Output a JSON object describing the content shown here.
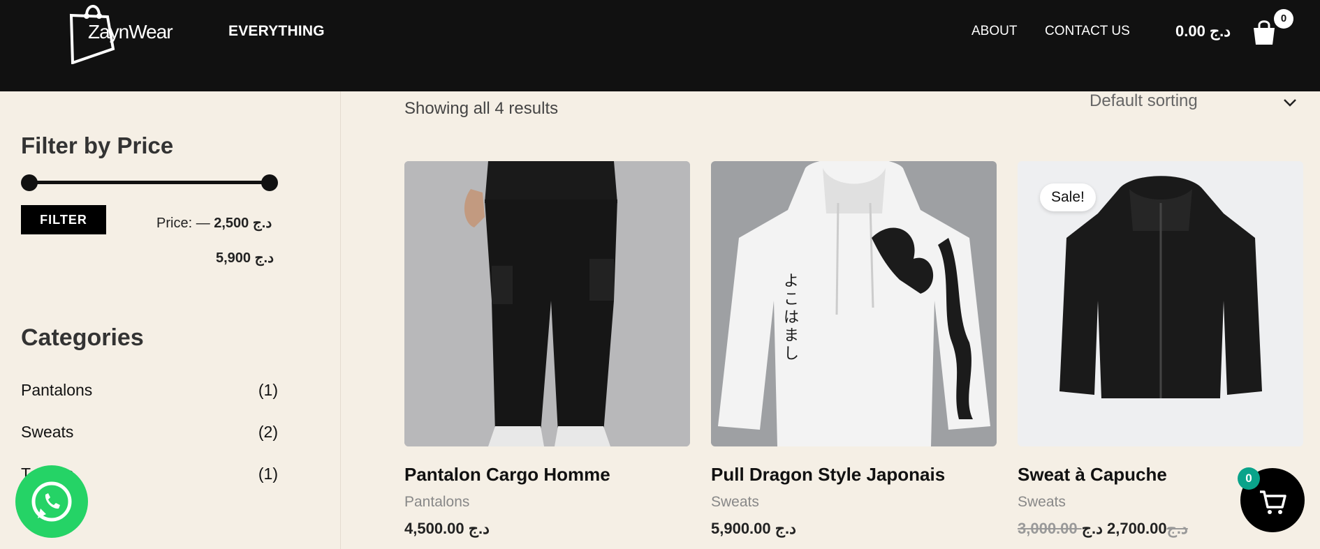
{
  "header": {
    "logo_text": "ZaynWear",
    "nav_everything": "EVERYTHING",
    "nav_about": "ABOUT",
    "nav_contact": "CONTACT US",
    "cart_total": "0.00 د.ج",
    "cart_count": "0"
  },
  "sidebar": {
    "filter_title": "Filter by Price",
    "filter_button": "FILTER",
    "price_label": "Price:",
    "price_min": "2,500 د.ج",
    "price_sep": "—",
    "price_max": "5,900 د.ج",
    "slider_min_fraction": 0,
    "slider_max_fraction": 1,
    "categories_title": "Categories",
    "categories": [
      {
        "label": "Pantalons",
        "count": "(1)"
      },
      {
        "label": "Sweats",
        "count": "(2)"
      },
      {
        "label": "T-shirts",
        "count": "(1)"
      }
    ]
  },
  "results": {
    "count_text": "Showing all 4 results",
    "sorting": "Default sorting"
  },
  "products": [
    {
      "name": "Pantalon Cargo Homme",
      "category": "Pantalons",
      "price": "4,500.00 د.ج"
    },
    {
      "name": "Pull Dragon Style Japonais",
      "category": "Sweats",
      "price": "5,900.00 د.ج",
      "sleeve_text": "よこはまし"
    },
    {
      "name": "Sweat à Capuche",
      "category": "Sweats",
      "old_price": "3,000.00 د.ج",
      "price": "2,700.00 د.ج",
      "badge": "Sale!"
    }
  ],
  "floating": {
    "cart_count": "0",
    "whatsapp_icon": "whatsapp-icon",
    "cart_icon": "cart-icon"
  },
  "colors": {
    "header_bg": "#111111",
    "page_bg": "#f5efe5",
    "whatsapp": "#25d366",
    "cart_badge": "#0aa38a"
  }
}
